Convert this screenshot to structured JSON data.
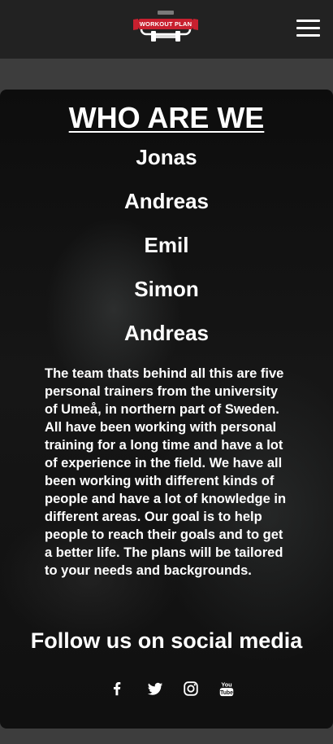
{
  "header": {
    "logo_text": "WORKOUT PLAN",
    "menu_icon": "hamburger-menu-icon",
    "brand_color": "#c8202f"
  },
  "about": {
    "title": "WHO ARE WE",
    "names": [
      "Jonas",
      "Andreas",
      "Emil",
      "Simon",
      "Andreas"
    ],
    "description": "The team thats behind all this are five personal trainers from the university of Umeå, in northern part of Sweden. All have been working with personal training for a long time and have a lot of experience in the field. We have all been working with different kinds of people and have a lot of knowledge in different areas. Our goal is to help people to reach their goals and to get a better life. The plans will be tailored to your needs and backgrounds."
  },
  "social": {
    "heading": "Follow us on social media",
    "icons": [
      "facebook-icon",
      "twitter-icon",
      "instagram-icon",
      "youtube-icon"
    ]
  }
}
